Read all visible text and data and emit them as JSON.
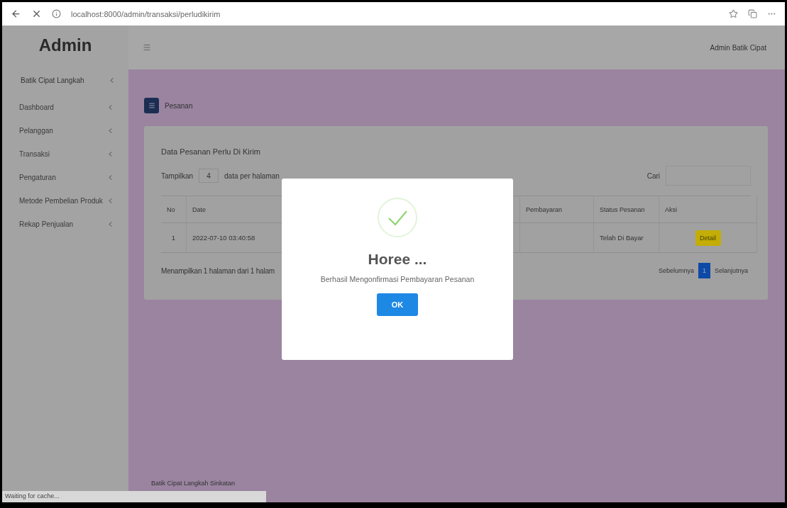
{
  "browser": {
    "url": "localhost:8000/admin/transaksi/perludikirim",
    "status": "Waiting for cache..."
  },
  "sidebar": {
    "title": "Admin",
    "profile": "Batik Cipat Langkah",
    "items": [
      {
        "label": "Dashboard",
        "selected": false
      },
      {
        "label": "Pelanggan",
        "selected": false
      },
      {
        "label": "Transaksi",
        "selected": false
      },
      {
        "label": "Pengaturan",
        "selected": false
      },
      {
        "label": "Metode Pembelian Produk",
        "selected": false
      },
      {
        "label": "Rekap Penjualan",
        "selected": false
      }
    ]
  },
  "header": {
    "user": "Admin Batik Cipat"
  },
  "page_title": "Pesanan",
  "card": {
    "title": "Data Pesanan Perlu Di Kirim",
    "show_label": "Tampilkan",
    "page_size": "4",
    "per_page_label": "data per halaman",
    "search_label": "Cari",
    "columns": [
      "No",
      "Date",
      "Pembayaran",
      "Status Pesanan",
      "Aksi"
    ],
    "rows": [
      {
        "no": "1",
        "date": "2022-07-10 03:40:58",
        "status": "Telah Di Bayar",
        "action": "Detail"
      }
    ],
    "summary": "Menampilkan 1 halaman dari 1 halam",
    "pagination": [
      {
        "label": "Sebelumnya",
        "selected": false
      },
      {
        "label": "1",
        "selected": true
      },
      {
        "label": "Selanjutnya",
        "selected": false
      }
    ]
  },
  "footer": "Batik Cipat Langkah Sinkatan",
  "dialog": {
    "title": "Horee ...",
    "message": "Berhasil Mengonfirmasi Pembayaran Pesanan",
    "button": "OK"
  }
}
